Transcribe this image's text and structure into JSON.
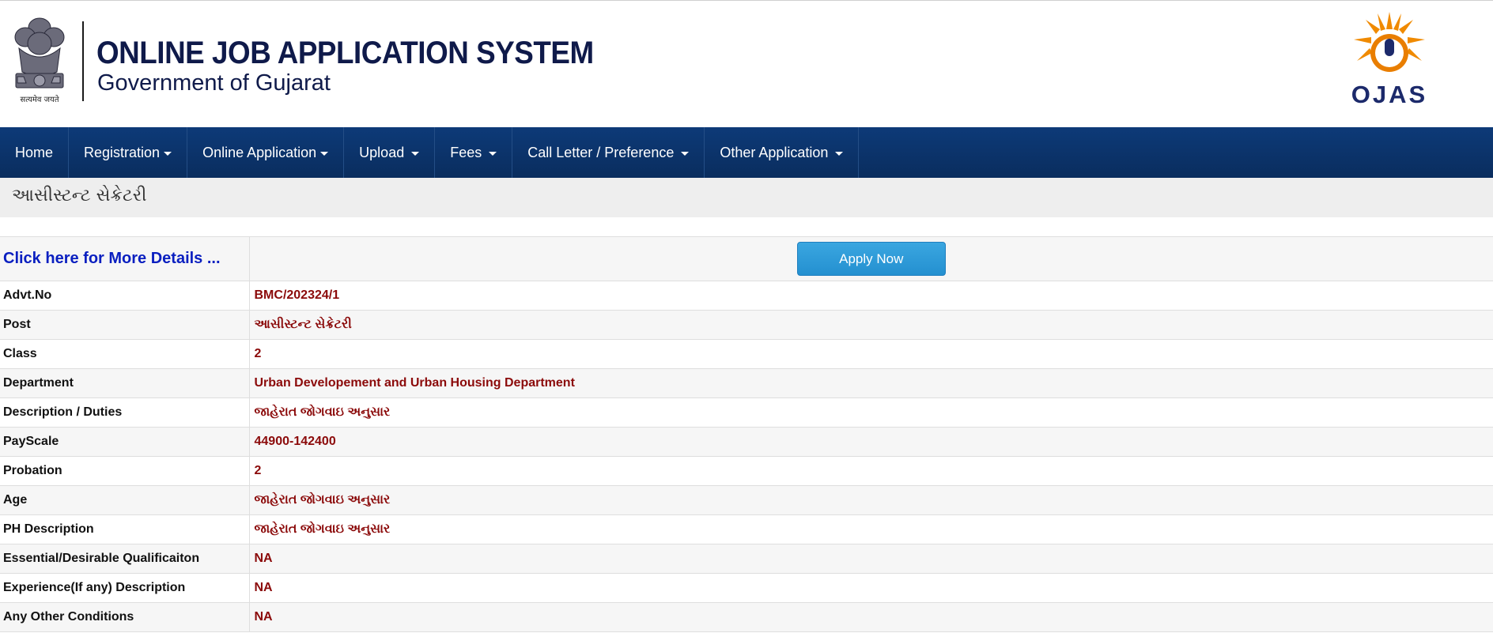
{
  "header": {
    "title": "ONLINE JOB APPLICATION SYSTEM",
    "subtitle": "Government of Gujarat",
    "emblem_caption": "सत्यमेव जयते",
    "brand_logo_text": "OJAS",
    "colors": {
      "title": "#0f1a4a",
      "navbar": "#0b3368",
      "brand_orange": "#f08a00"
    }
  },
  "nav": {
    "items": [
      {
        "label": "Home",
        "has_dropdown": false
      },
      {
        "label": "Registration",
        "has_dropdown": true
      },
      {
        "label": "Online Application",
        "has_dropdown": true
      },
      {
        "label": "Upload",
        "has_dropdown": true
      },
      {
        "label": "Fees",
        "has_dropdown": true
      },
      {
        "label": "Call Letter / Preference",
        "has_dropdown": true
      },
      {
        "label": "Other Application",
        "has_dropdown": true
      }
    ]
  },
  "page": {
    "heading": "આસીસ્ટન્ટ સેક્રેટરી",
    "more_details_link": "Click here for More Details ...",
    "apply_button": "Apply Now"
  },
  "details": [
    {
      "label": "Advt.No",
      "value": "BMC/202324/1"
    },
    {
      "label": "Post",
      "value": "આસીસ્ટન્ટ સેક્રેટરી"
    },
    {
      "label": "Class",
      "value": "2"
    },
    {
      "label": "Department",
      "value": "Urban Developement and Urban Housing Department"
    },
    {
      "label": "Description / Duties",
      "value": "જાહેરાત જોગવાઇ અનુસાર"
    },
    {
      "label": "PayScale",
      "value": "44900-142400"
    },
    {
      "label": "Probation",
      "value": "2"
    },
    {
      "label": "Age",
      "value": "જાહેરાત જોગવાઇ અનુસાર"
    },
    {
      "label": "PH Description",
      "value": "જાહેરાત જોગવાઇ અનુસાર"
    },
    {
      "label": "Essential/Desirable Qualificaiton",
      "value": "NA"
    },
    {
      "label": "Experience(If any) Description",
      "value": "NA"
    },
    {
      "label": "Any Other Conditions",
      "value": "NA"
    }
  ]
}
